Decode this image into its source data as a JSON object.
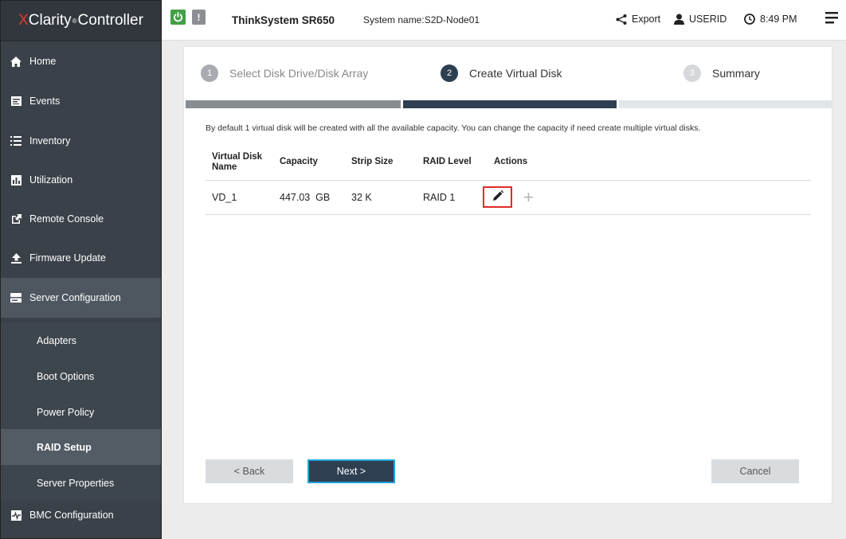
{
  "brand": {
    "x": "X",
    "rest": "Clarity",
    "reg": "®",
    "suffix": "Controller"
  },
  "sidebar": {
    "items": [
      {
        "label": "Home"
      },
      {
        "label": "Events"
      },
      {
        "label": "Inventory"
      },
      {
        "label": "Utilization"
      },
      {
        "label": "Remote Console"
      },
      {
        "label": "Firmware Update"
      },
      {
        "label": "Server Configuration"
      }
    ],
    "sub_items": [
      {
        "label": "Adapters"
      },
      {
        "label": "Boot Options"
      },
      {
        "label": "Power Policy"
      },
      {
        "label": "RAID Setup"
      },
      {
        "label": "Server Properties"
      }
    ],
    "bottom_item": {
      "label": "BMC Configuration"
    }
  },
  "header": {
    "alert": "!",
    "product": "ThinkSystem SR650",
    "system_name": "System name:S2D-Node01",
    "export": "Export",
    "user": "USERID",
    "time": "8:49 PM"
  },
  "wizard": {
    "steps": [
      {
        "num": "1",
        "label": "Select Disk Drive/Disk Array"
      },
      {
        "num": "2",
        "label": "Create Virtual Disk"
      },
      {
        "num": "3",
        "label": "Summary"
      }
    ],
    "hint": "By default 1 virtual disk will be created with all the available capacity. You can change the capacity if need create multiple virtual disks.",
    "columns": [
      "Virtual Disk Name",
      "Capacity",
      "Strip Size",
      "RAID Level",
      "Actions"
    ],
    "rows": [
      {
        "name": "VD_1",
        "capacity": "447.03  GB",
        "strip": "32 K",
        "raid": "RAID 1"
      }
    ],
    "back": "< Back",
    "next": "Next >",
    "cancel": "Cancel"
  },
  "colors": {
    "accent": "#2e3f52",
    "highlight": "#e02b2b",
    "power": "#43a047"
  }
}
